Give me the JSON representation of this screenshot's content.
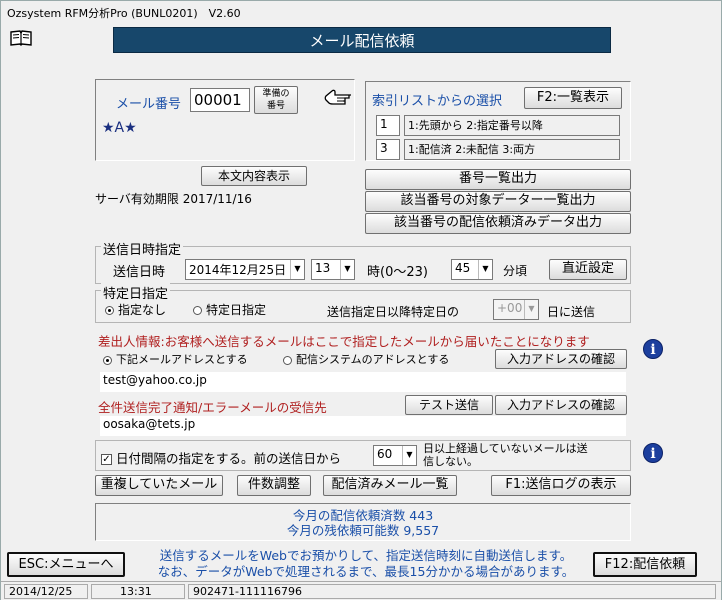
{
  "window": {
    "title": "Ozsystem RFM分析Pro (BUNL0201)　V2.60"
  },
  "banner": {
    "title": "メール配信依頼"
  },
  "icons": {
    "book": "book-icon",
    "hand": "pointing-hand-icon",
    "info": "info-icon"
  },
  "mail_no": {
    "label": "メール番号",
    "value": "00001",
    "prepare_line1": "準備の",
    "prepare_line2": "番号",
    "marks": "★A★"
  },
  "body_button": "本文内容表示",
  "server_expiry": "サーバ有効期限 2017/11/16",
  "index_panel": {
    "title": "索引リストからの選択",
    "list_button": "F2:一覧表示",
    "row1_value": "1",
    "row1_desc": "1:先頭から 2:指定番号以降",
    "row2_value": "3",
    "row2_desc": "1:配信済 2:未配信 3:両方"
  },
  "output_buttons": {
    "number_list": "番号一覧出力",
    "target_data": "該当番号の対象データー一覧出力",
    "requested_data": "該当番号の配信依頼済みデータ出力"
  },
  "schedule": {
    "group_title": "送信日時指定",
    "label": "送信日時",
    "date": "2014年12月25日",
    "hour": "13",
    "hour_label": "時(0〜23)",
    "minute": "45",
    "minute_label": "分頃",
    "recent_button": "直近設定"
  },
  "specific_day": {
    "group_title": "特定日指定",
    "opt_none": "指定なし",
    "opt_specific": "特定日指定",
    "after_label": "送信指定日以降特定日の",
    "day_value": "+00",
    "send_label": "日に送信"
  },
  "sender": {
    "notice": "差出人情報:お客様へ送信するメールはここで指定したメールから届いたことになります",
    "opt_below": "下記メールアドレスとする",
    "opt_system": "配信システムのアドレスとする",
    "confirm_button": "入力アドレスの確認",
    "address": "test@yahoo.co.jp"
  },
  "completion": {
    "label": "全件送信完了通知/エラーメールの受信先",
    "test_button": "テスト送信",
    "confirm_button": "入力アドレスの確認",
    "address": "oosaka@tets.jp"
  },
  "interval": {
    "label": "日付間隔の指定をする。前の送信日から",
    "value": "60",
    "desc_line1": "日以上経過していないメールは送",
    "desc_line2": "信しない。"
  },
  "actions": {
    "duplicate": "重複していたメール",
    "count_adjust": "件数調整",
    "sent_list": "配信済みメール一覧",
    "log": "F1:送信ログの表示"
  },
  "monthly": {
    "requested": "今月の配信依頼済数 443",
    "remaining": "今月の残依頼可能数 9,557"
  },
  "footer": {
    "esc_button": "ESC:メニューへ",
    "note_line1": "送信するメールをWebでお預かりして、指定送信時刻に自動送信します。",
    "note_line2": "なお、データがWebで処理されるまで、最長15分かかる場合があります。",
    "f12_button": "F12:配信依頼"
  },
  "status": {
    "date": "2014/12/25",
    "time": "13:31",
    "code": "902471-111116796"
  }
}
